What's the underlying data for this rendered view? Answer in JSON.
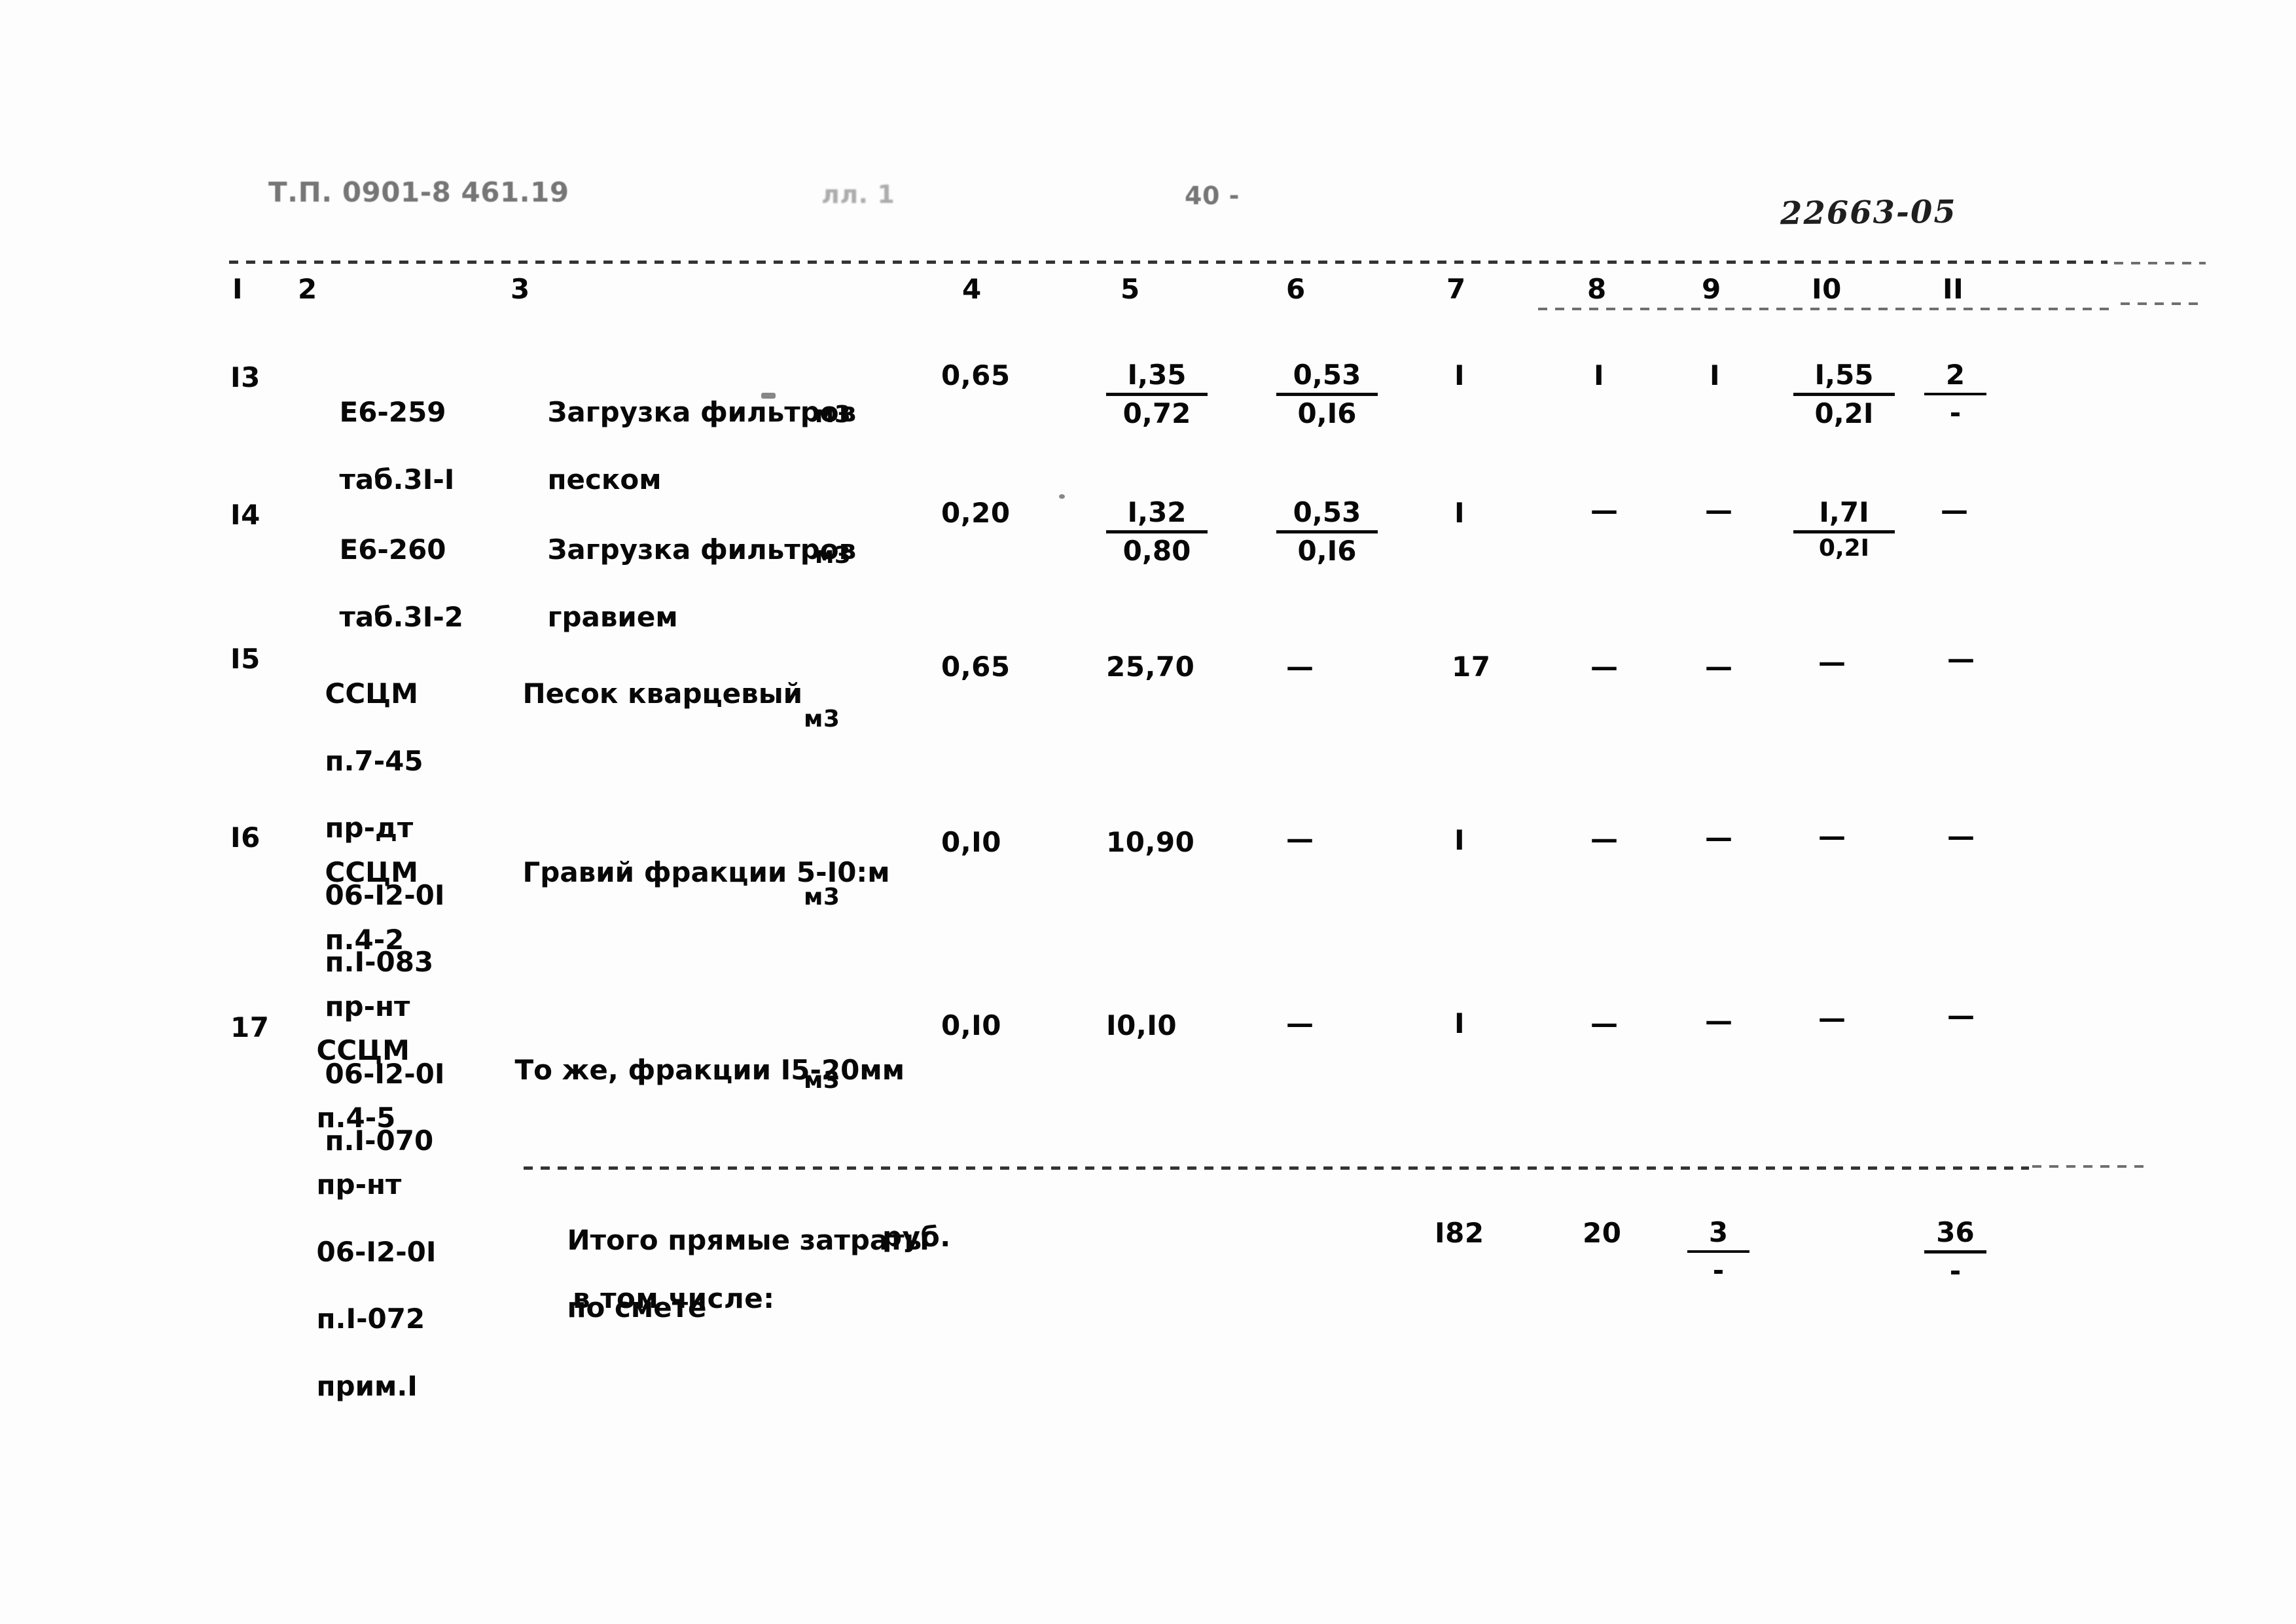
{
  "document": {
    "header_left": "Т.П. 0901-8 461.19",
    "header_sheet": "лл. 1",
    "header_page": "40 -",
    "header_stamp": "22663-05"
  },
  "table": {
    "column_headers": [
      "I",
      "2",
      "3",
      "4",
      "5",
      "6",
      "7",
      "8",
      "9",
      "I0",
      "II"
    ],
    "rows": [
      {
        "num": "I3",
        "code_lines": [
          "Е6-259",
          "таб.3I-I"
        ],
        "description_lines": [
          "Загрузка фильтров",
          "песком"
        ],
        "unit": "м3",
        "c4": "0,65",
        "c5": {
          "num": "I,35",
          "den": "0,72"
        },
        "c6": {
          "num": "0,53",
          "den": "0,I6"
        },
        "c7": "I",
        "c8": "I",
        "c9": "I",
        "c10": {
          "num": "I,55",
          "den": "0,2I"
        },
        "c11": {
          "num": "2",
          "den": "-"
        }
      },
      {
        "num": "I4",
        "code_lines": [
          "Е6-260",
          "таб.3I-2"
        ],
        "description_lines": [
          "Загрузка фильтров",
          "гравием"
        ],
        "unit": "м3",
        "c4": "0,20",
        "c5": {
          "num": "I,32",
          "den": "0,80"
        },
        "c6": {
          "num": "0,53",
          "den": "0,I6"
        },
        "c7": "I",
        "c8": "—",
        "c9": "—",
        "c10": {
          "num": "I,7I",
          "den": "0,2I"
        },
        "c11": "—"
      },
      {
        "num": "I5",
        "code_lines": [
          "ССЦМ",
          "п.7-45",
          "пр-дт",
          "06-I2-0I",
          "п.I-083"
        ],
        "description_lines": [
          "Песок кварцевый"
        ],
        "unit": "м3",
        "c4": "0,65",
        "c5": "25,70",
        "c6": "—",
        "c7": "17",
        "c8": "—",
        "c9": "—",
        "c10": "—",
        "c11": "—"
      },
      {
        "num": "I6",
        "code_lines": [
          "ССЦМ",
          "п.4-2",
          "пр-нт",
          "06-I2-0I",
          "п.I-070"
        ],
        "description_lines": [
          "Гравий фракции 5-I0:м"
        ],
        "unit": "м3",
        "c4": "0,I0",
        "c5": "10,90",
        "c6": "—",
        "c7": "I",
        "c8": "—",
        "c9": "—",
        "c10": "—",
        "c11": "—"
      },
      {
        "num": "17",
        "code_lines": [
          "ССЦМ",
          "п.4-5",
          "пр-нт",
          "06-I2-0I",
          "п.I-072",
          "прим.I"
        ],
        "description_lines": [
          "То же, фракции I5-20мм"
        ],
        "unit": "м3",
        "c4": "0,I0",
        "c5": "I0,I0",
        "c6": "—",
        "c7": "I",
        "c8": "—",
        "c9": "—",
        "c10": "—",
        "c11": "—"
      }
    ],
    "totals": {
      "label_line1": "Итого прямые затраты",
      "label_line2": "по смете",
      "unit": "руб.",
      "sub_label": "в том числе:",
      "c7": "I82",
      "c8": "20",
      "c9": {
        "num": "3",
        "den": "-"
      },
      "c10": {
        "num": "36",
        "den": "-"
      }
    }
  }
}
